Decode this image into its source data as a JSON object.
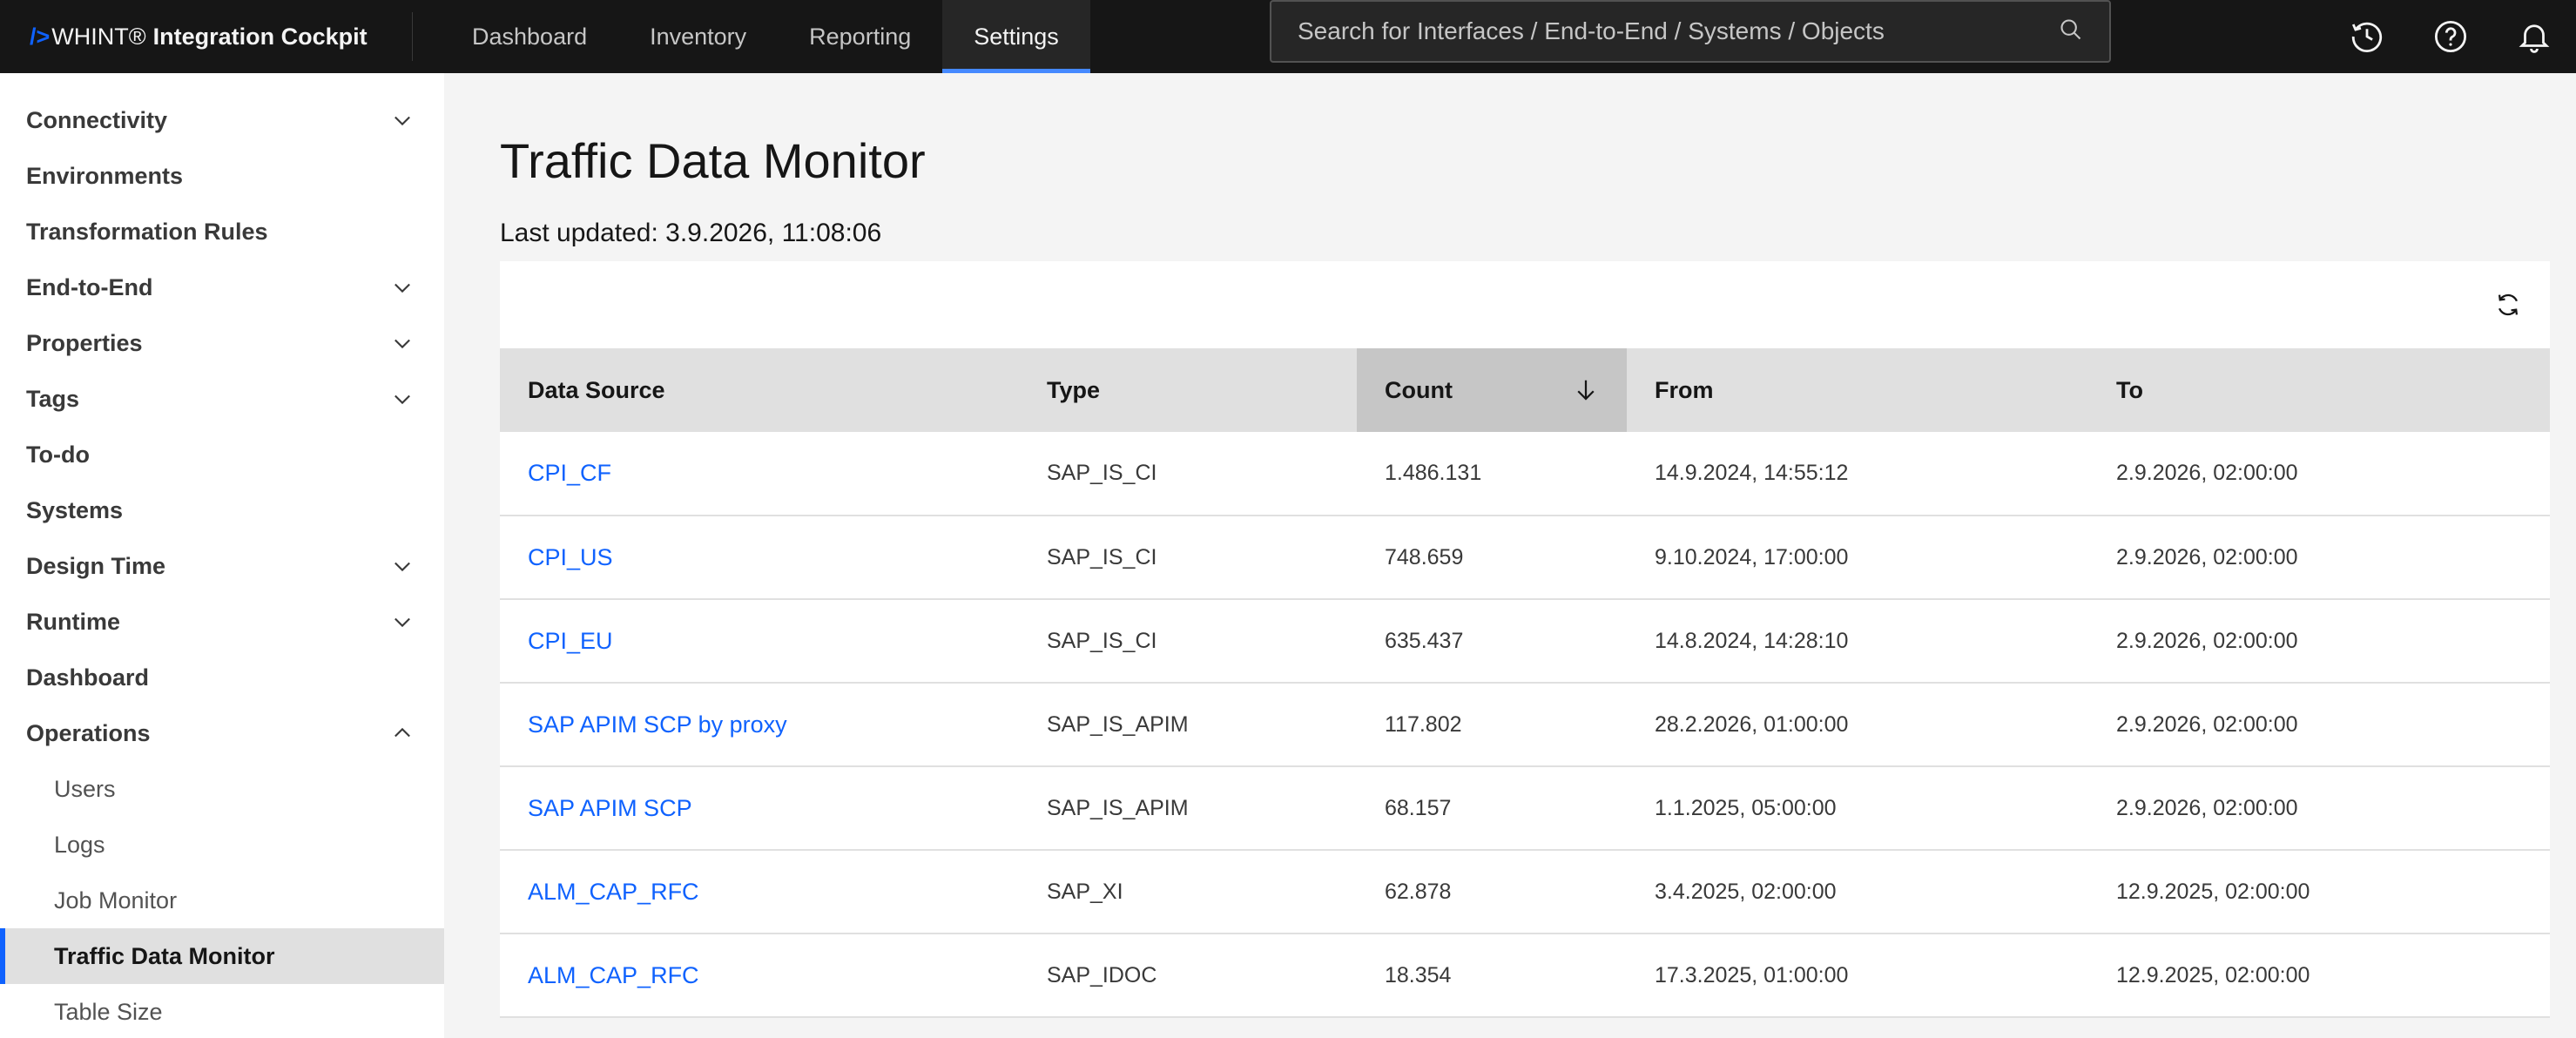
{
  "header": {
    "brand_prefix": "/>",
    "brand_name": "WHINT®",
    "brand_product": "Integration Cockpit",
    "nav": [
      "Dashboard",
      "Inventory",
      "Reporting",
      "Settings"
    ],
    "active_nav": "Settings",
    "search_placeholder": "Search for Interfaces / End-to-End / Systems / Objects",
    "icons": [
      "history-icon",
      "help-icon",
      "notification-icon"
    ]
  },
  "sidebar": {
    "items": [
      {
        "label": "Connectivity",
        "chevron": "down"
      },
      {
        "label": "Environments"
      },
      {
        "label": "Transformation Rules"
      },
      {
        "label": "End-to-End",
        "chevron": "down"
      },
      {
        "label": "Properties",
        "chevron": "down"
      },
      {
        "label": "Tags",
        "chevron": "down"
      },
      {
        "label": "To-do"
      },
      {
        "label": "Systems"
      },
      {
        "label": "Design Time",
        "chevron": "down"
      },
      {
        "label": "Runtime",
        "chevron": "down"
      },
      {
        "label": "Dashboard"
      },
      {
        "label": "Operations",
        "chevron": "up"
      }
    ],
    "sub_items": [
      "Users",
      "Logs",
      "Job Monitor",
      "Traffic Data Monitor",
      "Table Size"
    ],
    "active_sub": "Traffic Data Monitor"
  },
  "main": {
    "title": "Traffic Data Monitor",
    "last_updated": "Last updated: 3.9.2026, 11:08:06",
    "columns": [
      "Data Source",
      "Type",
      "Count",
      "From",
      "To"
    ],
    "sorted_column": "Count",
    "sort_direction": "descending",
    "rows": [
      [
        "CPI_CF",
        "SAP_IS_CI",
        "1.486.131",
        "14.9.2024, 14:55:12",
        "2.9.2026, 02:00:00"
      ],
      [
        "CPI_US",
        "SAP_IS_CI",
        "748.659",
        "9.10.2024, 17:00:00",
        "2.9.2026, 02:00:00"
      ],
      [
        "CPI_EU",
        "SAP_IS_CI",
        "635.437",
        "14.8.2024, 14:28:10",
        "2.9.2026, 02:00:00"
      ],
      [
        "SAP APIM SCP by proxy",
        "SAP_IS_APIM",
        "117.802",
        "28.2.2026, 01:00:00",
        "2.9.2026, 02:00:00"
      ],
      [
        "SAP APIM SCP",
        "SAP_IS_APIM",
        "68.157",
        "1.1.2025, 05:00:00",
        "2.9.2026, 02:00:00"
      ],
      [
        "ALM_CAP_RFC",
        "SAP_XI",
        "62.878",
        "3.4.2025, 02:00:00",
        "12.9.2025, 02:00:00"
      ],
      [
        "ALM_CAP_RFC",
        "SAP_IDOC",
        "18.354",
        "17.3.2025, 01:00:00",
        "12.9.2025, 02:00:00"
      ]
    ]
  },
  "colors": {
    "header_bg": "#161616",
    "accent": "#0f62fe",
    "active_tab_line": "#4589ff",
    "page_bg": "#f4f4f4"
  }
}
